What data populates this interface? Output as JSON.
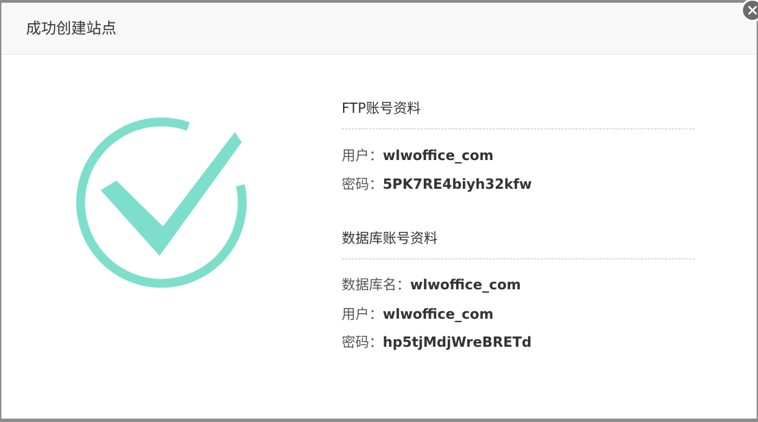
{
  "dialog": {
    "title": "成功创建站点",
    "close_icon": "close-icon"
  },
  "icon": {
    "name": "check-circle-icon",
    "color": "#7ddfcb"
  },
  "ftp": {
    "heading": "FTP账号资料",
    "user_label": "用户：",
    "user_value": "wlwoffice_com",
    "password_label": "密码：",
    "password_value": "5PK7RE4biyh32kfw"
  },
  "database": {
    "heading": "数据库账号资料",
    "name_label": "数据库名：",
    "name_value": "wlwoffice_com",
    "user_label": "用户：",
    "user_value": "wlwoffice_com",
    "password_label": "密码：",
    "password_value": "hp5tjMdjWreBRETd"
  }
}
